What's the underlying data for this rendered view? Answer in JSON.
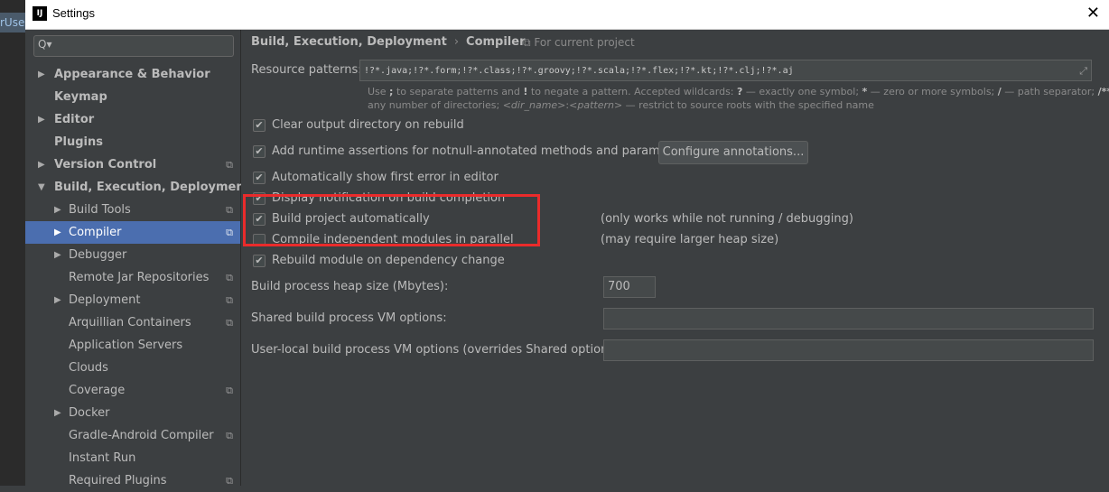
{
  "window": {
    "title": "Settings",
    "app_icon": "IJ",
    "close_glyph": "✕"
  },
  "outer": {
    "tab_text": "rUse"
  },
  "sidebar": {
    "search_icon": "Q▾",
    "items": [
      {
        "label": "Appearance & Behavior",
        "bold": true,
        "arrow": "▶",
        "level": 0
      },
      {
        "label": "Keymap",
        "bold": true,
        "arrow": "",
        "level": 0
      },
      {
        "label": "Editor",
        "bold": true,
        "arrow": "▶",
        "level": 0
      },
      {
        "label": "Plugins",
        "bold": true,
        "arrow": "",
        "level": 0
      },
      {
        "label": "Version Control",
        "bold": true,
        "arrow": "▶",
        "level": 0,
        "project": true
      },
      {
        "label": "Build, Execution, Deployment",
        "bold": true,
        "arrow": "▼",
        "level": 0
      },
      {
        "label": "Build Tools",
        "bold": false,
        "arrow": "▶",
        "level": 1,
        "project": true
      },
      {
        "label": "Compiler",
        "bold": false,
        "arrow": "▶",
        "level": 1,
        "project": true,
        "selected": true
      },
      {
        "label": "Debugger",
        "bold": false,
        "arrow": "▶",
        "level": 1
      },
      {
        "label": "Remote Jar Repositories",
        "bold": false,
        "arrow": "",
        "level": 1,
        "project": true
      },
      {
        "label": "Deployment",
        "bold": false,
        "arrow": "▶",
        "level": 1,
        "project": true
      },
      {
        "label": "Arquillian Containers",
        "bold": false,
        "arrow": "",
        "level": 1,
        "project": true
      },
      {
        "label": "Application Servers",
        "bold": false,
        "arrow": "",
        "level": 1
      },
      {
        "label": "Clouds",
        "bold": false,
        "arrow": "",
        "level": 1
      },
      {
        "label": "Coverage",
        "bold": false,
        "arrow": "",
        "level": 1,
        "project": true
      },
      {
        "label": "Docker",
        "bold": false,
        "arrow": "▶",
        "level": 1
      },
      {
        "label": "Gradle-Android Compiler",
        "bold": false,
        "arrow": "",
        "level": 1,
        "project": true
      },
      {
        "label": "Instant Run",
        "bold": false,
        "arrow": "",
        "level": 1
      },
      {
        "label": "Required Plugins",
        "bold": false,
        "arrow": "",
        "level": 1,
        "project": true
      }
    ]
  },
  "main": {
    "breadcrumb": {
      "parent": "Build, Execution, Deployment",
      "sep": "›",
      "current": "Compiler"
    },
    "for_project": "⧉ For current project",
    "resource_patterns": {
      "label": "Resource patterns:",
      "value": "!?*.java;!?*.form;!?*.class;!?*.groovy;!?*.scala;!?*.flex;!?*.kt;!?*.clj;!?*.aj"
    },
    "hint_line1": {
      "a": "Use ",
      "b": ";",
      "c": " to separate patterns and ",
      "d": "!",
      "e": " to negate a pattern. Accepted wildcards: ",
      "f": "?",
      "g": " — exactly one symbol; ",
      "h": "*",
      "i": " — zero or more symbols; ",
      "j": "/",
      "k": " — path separator; ",
      "l": "/**/",
      "m": " —"
    },
    "hint_line2": {
      "a": "any number of directories;  ",
      "b": "<dir_name>",
      "c": ":",
      "d": "<pattern>",
      "e": " — restrict to source roots with the specified name"
    },
    "checkboxes": [
      {
        "label": "Clear output directory on rebuild",
        "checked": true
      },
      {
        "label": "Add runtime assertions for notnull-annotated methods and parameters",
        "checked": true
      },
      {
        "label": "Automatically show first error in editor",
        "checked": true
      },
      {
        "label": "Display notification on build completion",
        "checked": true
      },
      {
        "label": "Build project automatically",
        "checked": true
      },
      {
        "label": "Compile independent modules in parallel",
        "checked": false
      },
      {
        "label": "Rebuild module on dependency change",
        "checked": true
      }
    ],
    "configure_button": "Configure annotations...",
    "note_auto": "(only works while not running / debugging)",
    "note_parallel": "(may require larger heap size)",
    "heap": {
      "label": "Build process heap size (Mbytes):",
      "value": "700"
    },
    "shared_vm": {
      "label": "Shared build process VM options:",
      "value": ""
    },
    "user_vm": {
      "label": "User-local build process VM options (overrides Shared options):",
      "value": ""
    },
    "project_icon": "⧉"
  },
  "colors": {
    "selection": "#4b6eaf",
    "highlight": "#ea2b2b",
    "panel": "#3c3f41"
  }
}
